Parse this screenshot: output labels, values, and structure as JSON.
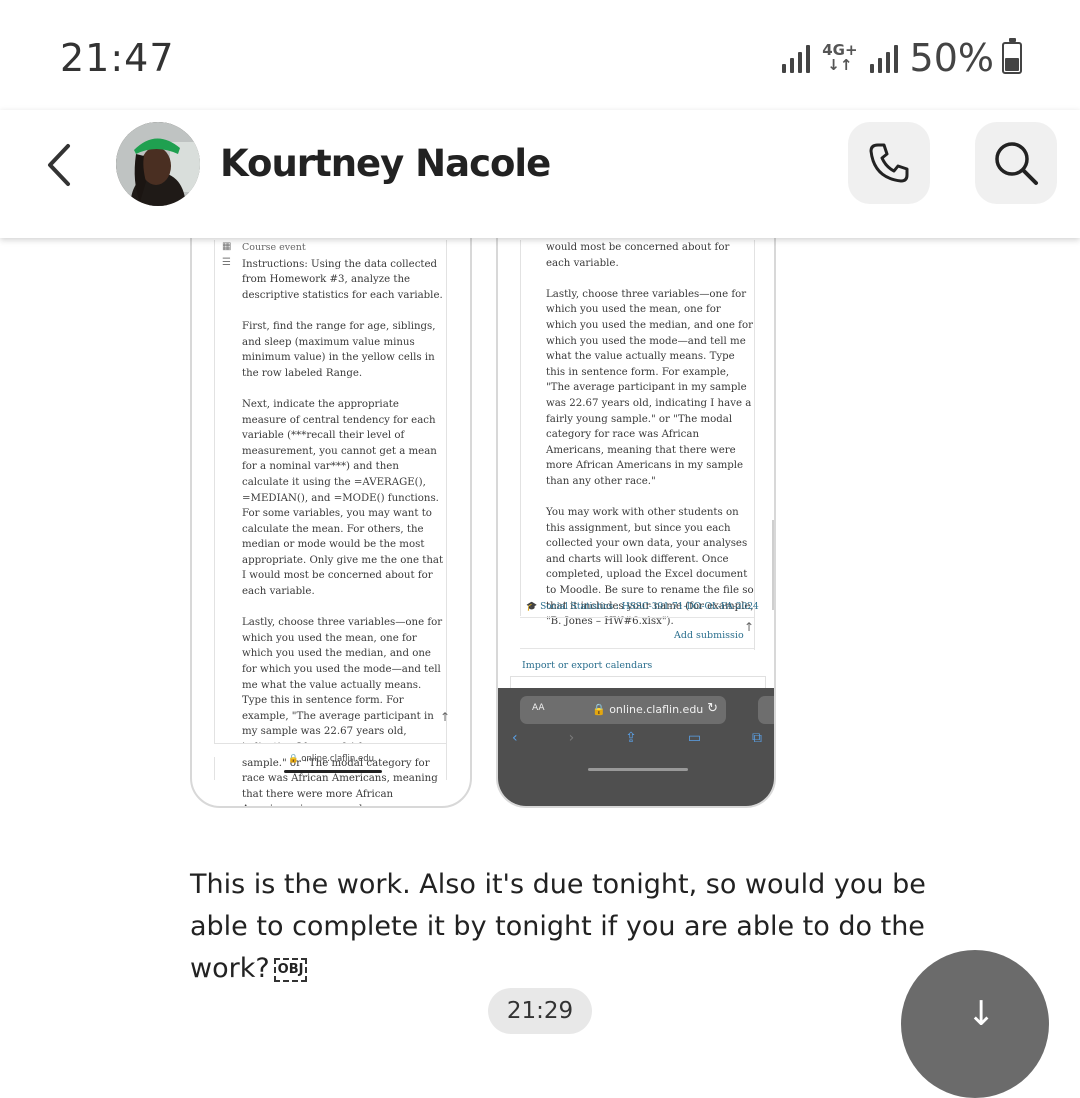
{
  "status_bar": {
    "time": "21:47",
    "network_type": "4G+",
    "battery_percent": "50%",
    "battery_level": 0.5
  },
  "chat_header": {
    "contact_name": "Kourtney Nacole",
    "icons": {
      "back": "chevron-left-icon",
      "call": "phone-icon",
      "search": "search-icon"
    }
  },
  "screenshot_left": {
    "course_event": "Course event",
    "paragraphs": [
      "Instructions: Using the data collected from Homework #3, analyze the descriptive statistics for each variable.",
      "First, find the range for age, siblings, and sleep (maximum value minus minimum value) in the yellow cells in the row labeled Range.",
      "Next, indicate the appropriate measure of central tendency for each variable (***recall their level of measurement, you cannot get a mean for a nominal var***) and then calculate it using the =AVERAGE(), =MEDIAN(), and =MODE() functions. For some variables, you may want to calculate the mean. For others, the median or mode would be the most appropriate. Only give me the one that I would most be concerned about for each variable.",
      "Lastly, choose three variables—one for which you used the mean, one for which you used the median, and one for which you used the mode—and tell me what the value actually means. Type this in sentence form. For example, \"The average participant in my sample was 22.67 years old, indicating I have a fairly young sample.\" or \"The modal category for race was African Americans, meaning that there were more African Americans in my sample"
    ],
    "url": "online.claflin.edu"
  },
  "screenshot_right": {
    "paragraphs": [
      "would most be concerned about for each variable.",
      "Lastly, choose three variables—one for which you used the mean, one for which you used the median, and one for which you used the mode—and tell me what the value actually means. Type this in sentence form. For example, \"The average participant in my sample was 22.67 years old, indicating I have a fairly young sample.\" or \"The modal category for race was African Americans, meaning that there were more African Americans in my sample than any other race.\"",
      "You may work with other students on this assignment, but since you each collected your own data, your analyses and charts will look different. Once completed, upload the Excel document to Moodle. Be sure to rename the file so that it includes your name (for example, \"B. Jones – HW#6.xlsx\")."
    ],
    "course_link": "Social Statistics : HSSC-391-71-DO-OL-FA-2024",
    "add_submission": "Add submissio",
    "import_export": "Import or export calendars",
    "browser": {
      "aa": "AA",
      "url": "online.claflin.edu"
    }
  },
  "message": {
    "text": "This is the work. Also it's due tonight, so would you be able to complete it by tonight if you are able to do the work?",
    "obj_mark": "OBJ"
  },
  "timestamp": "21:29"
}
